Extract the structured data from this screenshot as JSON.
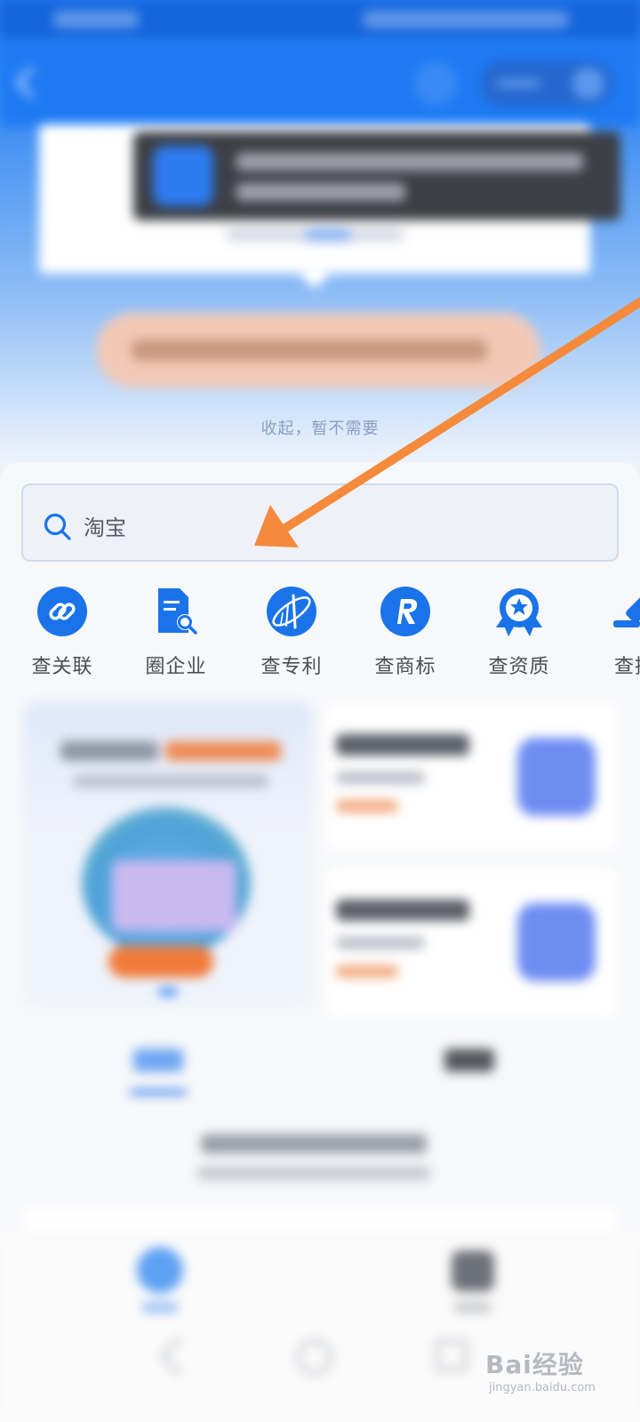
{
  "overlay": {
    "collapse_link": "收起，暂不需要"
  },
  "search": {
    "value": "淘宝"
  },
  "features": [
    {
      "label": "查关联",
      "icon": "link-icon"
    },
    {
      "label": "圈企业",
      "icon": "document-search-icon"
    },
    {
      "label": "查专利",
      "icon": "patent-icon"
    },
    {
      "label": "查商标",
      "icon": "trademark-r-icon"
    },
    {
      "label": "查资质",
      "icon": "award-ribbon-icon"
    },
    {
      "label": "查招",
      "icon": "bid-icon"
    }
  ],
  "watermark": {
    "brand": "Bai经验",
    "url": "jingyan.baidu.com"
  },
  "colors": {
    "primary": "#1e7af3",
    "icon_blue": "#1a73e8",
    "annotation_arrow": "#f58a3c"
  }
}
